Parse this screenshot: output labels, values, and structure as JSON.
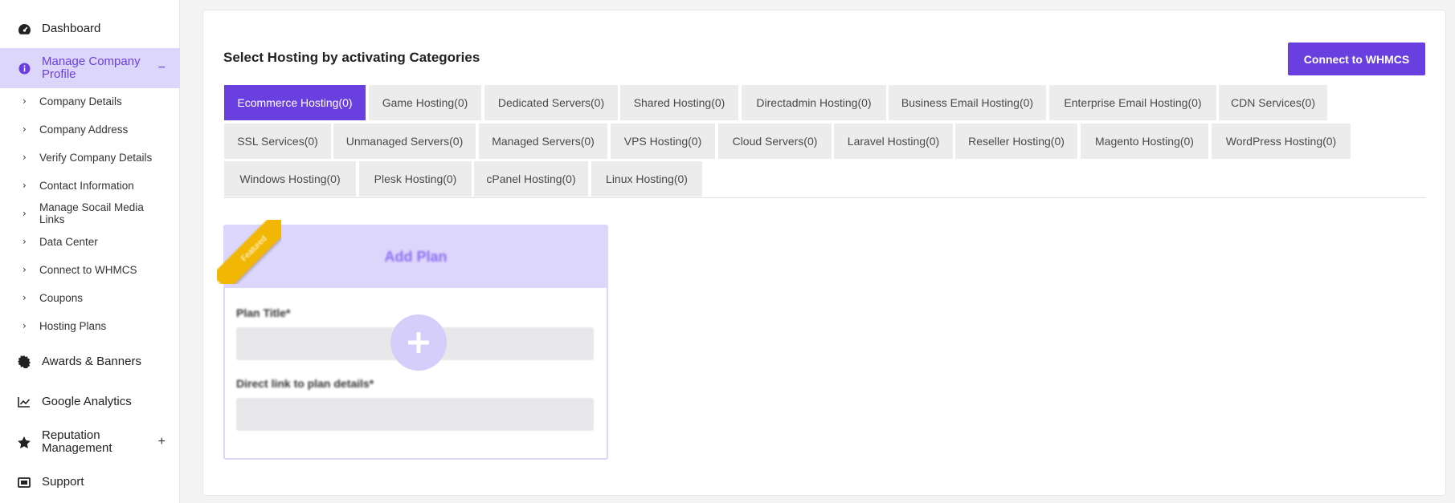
{
  "sidebar": {
    "dashboard": {
      "label": "Dashboard",
      "icon": "dashboard-gauge-icon"
    },
    "manage_company": {
      "label_line1": "Manage Company",
      "label_line2": "Profile",
      "icon": "info-icon",
      "toggle": "−"
    },
    "sub_items": [
      {
        "label": "Company Details"
      },
      {
        "label": "Company Address"
      },
      {
        "label": "Verify Company Details"
      },
      {
        "label": "Contact Information"
      },
      {
        "label": "Manage Socail Media Links"
      },
      {
        "label": "Data Center"
      },
      {
        "label": "Connect to WHMCS"
      },
      {
        "label": "Coupons"
      },
      {
        "label": "Hosting Plans"
      }
    ],
    "awards": {
      "label": "Awards & Banners",
      "icon": "badge-icon"
    },
    "analytics": {
      "label": "Google Analytics",
      "icon": "chart-line-icon"
    },
    "reputation": {
      "label_line1": "Reputation",
      "label_line2": "Management",
      "icon": "star-icon",
      "toggle": "+"
    },
    "support": {
      "label": "Support",
      "icon": "ticket-icon"
    }
  },
  "main": {
    "title": "Select Hosting by activating Categories",
    "connect_button": "Connect to WHMCS",
    "tabs": [
      {
        "label": "Ecommerce Hosting(0)",
        "active": true
      },
      {
        "label": "Game Hosting(0)"
      },
      {
        "label": "Dedicated Servers(0)"
      },
      {
        "label": "Shared Hosting(0)"
      },
      {
        "label": "Directadmin Hosting(0)"
      },
      {
        "label": "Business Email Hosting(0)"
      },
      {
        "label": "Enterprise Email Hosting(0)"
      },
      {
        "label": "CDN Services(0)"
      },
      {
        "label": "SSL Services(0)"
      },
      {
        "label": "Unmanaged Servers(0)"
      },
      {
        "label": "Managed Servers(0)"
      },
      {
        "label": "VPS Hosting(0)"
      },
      {
        "label": "Cloud Servers(0)"
      },
      {
        "label": "Laravel Hosting(0)"
      },
      {
        "label": "Reseller Hosting(0)"
      },
      {
        "label": "Magento Hosting(0)"
      },
      {
        "label": "WordPress Hosting(0)"
      },
      {
        "label": "Windows Hosting(0)"
      },
      {
        "label": "Plesk Hosting(0)"
      },
      {
        "label": "cPanel Hosting(0)"
      },
      {
        "label": "Linux Hosting(0)"
      }
    ],
    "plan_card": {
      "header": "Add Plan",
      "ribbon": "Featured",
      "plan_title_label": "Plan Title*",
      "link_label": "Direct link to plan details*",
      "add_icon": "plus-icon"
    }
  },
  "colors": {
    "accent": "#6a3fe0",
    "accent_light": "#ddd6fb",
    "tab_bg": "#ececec",
    "ribbon": "#f2b705"
  }
}
